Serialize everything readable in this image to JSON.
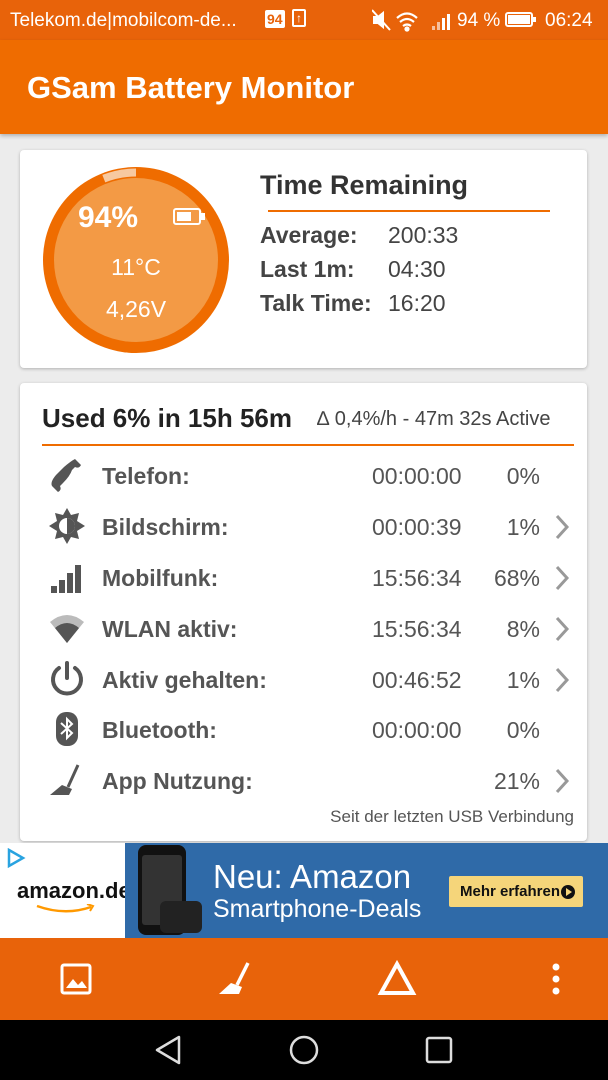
{
  "status_bar": {
    "carrier": "Telekom.de|mobilcom-de...",
    "badge": "94",
    "battery_pct": "94 %",
    "time": "06:24"
  },
  "app": {
    "title": "GSam Battery Monitor"
  },
  "battery": {
    "level_pct": 94,
    "percent": "94%",
    "temperature": "11°C",
    "voltage": "4,26V"
  },
  "time_remaining": {
    "title": "Time Remaining",
    "rows": [
      {
        "label": "Average:",
        "value": "200:33"
      },
      {
        "label": "Last 1m:",
        "value": "04:30"
      },
      {
        "label": "Talk Time:",
        "value": "16:20"
      }
    ]
  },
  "usage": {
    "title": "Used 6% in 15h 56m",
    "subtitle": "∆ 0,4%/h - 47m 32s Active",
    "rows": [
      {
        "icon": "phone-icon",
        "label": "Telefon:",
        "time": "00:00:00",
        "percent": "0%",
        "has_detail": false
      },
      {
        "icon": "brightness-icon",
        "label": "Bildschirm:",
        "time": "00:00:39",
        "percent": "1%",
        "has_detail": true
      },
      {
        "icon": "signal-bars-icon",
        "label": "Mobilfunk:",
        "time": "15:56:34",
        "percent": "68%",
        "has_detail": true
      },
      {
        "icon": "wifi-icon",
        "label": "WLAN aktiv:",
        "time": "15:56:34",
        "percent": "8%",
        "has_detail": true
      },
      {
        "icon": "power-icon",
        "label": "Aktiv gehalten:",
        "time": "00:46:52",
        "percent": "1%",
        "has_detail": true
      },
      {
        "icon": "bluetooth-icon",
        "label": "Bluetooth:",
        "time": "00:00:00",
        "percent": "0%",
        "has_detail": false
      },
      {
        "icon": "broom-icon",
        "label": "App Nutzung:",
        "time": "",
        "percent": "21%",
        "has_detail": true
      }
    ],
    "footnote": "Seit der letzten USB Verbindung"
  },
  "ad": {
    "brand": "amazon.de",
    "line1": "Neu: Amazon",
    "line2": "Smartphone-Deals",
    "cta": "Mehr erfahren"
  },
  "bottom_bar": {
    "items": [
      "image-icon",
      "broom-icon",
      "delta-icon",
      "more-vert-icon"
    ]
  },
  "nav_bar": {
    "items": [
      "back-icon",
      "home-icon",
      "recents-icon"
    ]
  },
  "colors": {
    "primary": "#ef6c00",
    "status_bar": "#e8630a",
    "gauge_fill": "#f39a45",
    "ad_blue": "#2f6aa8",
    "cta_yellow": "#f5d57a"
  }
}
